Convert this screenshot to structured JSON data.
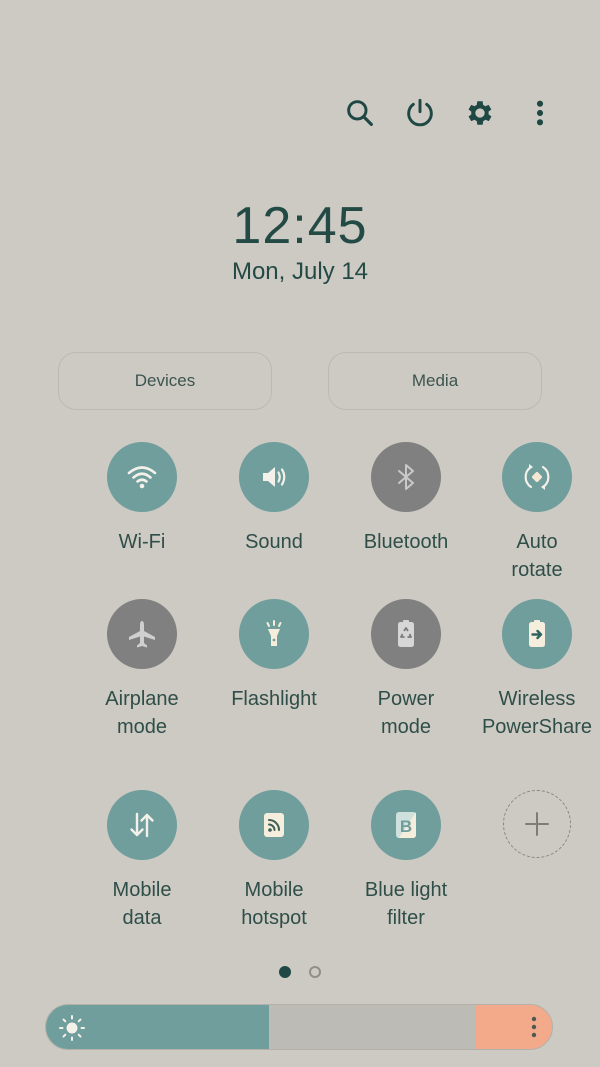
{
  "top_actions": [
    {
      "name": "search",
      "icon": "search-icon"
    },
    {
      "name": "power",
      "icon": "power-icon"
    },
    {
      "name": "settings",
      "icon": "gear-icon"
    },
    {
      "name": "more",
      "icon": "more-vertical-icon"
    }
  ],
  "clock": {
    "time": "12:45",
    "date": "Mon, July 14"
  },
  "pills": {
    "devices": "Devices",
    "media": "Media"
  },
  "tiles": [
    {
      "label": "Wi-Fi",
      "state": "on",
      "icon": "wifi-icon"
    },
    {
      "label": "Sound",
      "state": "on",
      "icon": "speaker-icon"
    },
    {
      "label": "Bluetooth",
      "state": "off",
      "icon": "bluetooth-icon"
    },
    {
      "label": "Auto\nrotate",
      "state": "on",
      "icon": "auto-rotate-icon"
    },
    {
      "label": "Airplane\nmode",
      "state": "off",
      "icon": "airplane-icon"
    },
    {
      "label": "Flashlight",
      "state": "on",
      "icon": "flashlight-icon"
    },
    {
      "label": "Power\nmode",
      "state": "off",
      "icon": "power-mode-icon"
    },
    {
      "label": "Wireless\nPowerShare",
      "state": "on",
      "icon": "wireless-powershare-icon"
    },
    {
      "label": "Mobile\ndata",
      "state": "on",
      "icon": "mobile-data-icon"
    },
    {
      "label": "Mobile\nhotspot",
      "state": "on",
      "icon": "hotspot-icon"
    },
    {
      "label": "Blue light\nfilter",
      "state": "on",
      "icon": "blue-light-filter-icon"
    },
    {
      "label": "",
      "state": "add",
      "icon": "plus-icon"
    }
  ],
  "pagination": {
    "current": 1,
    "total": 2
  },
  "brightness": {
    "level_percent": 44
  },
  "colors": {
    "background": "#cdcac3",
    "tile_on": "#6f9e9c",
    "tile_off": "#808080",
    "text": "#234a45",
    "brightness_more": "#f2aa8b"
  }
}
